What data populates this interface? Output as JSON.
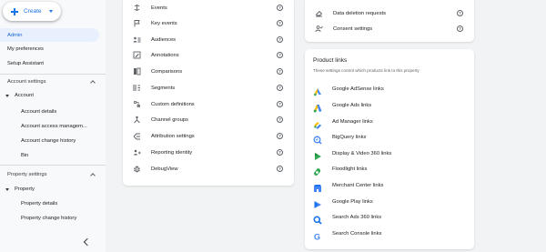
{
  "sidebar": {
    "create_label": "Create",
    "admin_label": "Admin",
    "my_preferences_label": "My preferences",
    "setup_assistant_label": "Setup Assistant",
    "account_settings": {
      "heading": "Account settings",
      "tree_label": "Account",
      "items": [
        "Account details",
        "Account access managem...",
        "Account change history",
        "Bin"
      ]
    },
    "property_settings": {
      "heading": "Property settings",
      "tree_label": "Property",
      "items": [
        "Property details",
        "Property change history"
      ]
    }
  },
  "data_display": {
    "items": [
      {
        "label": "Events",
        "icon": "events-icon"
      },
      {
        "label": "Key events",
        "icon": "flag-icon"
      },
      {
        "label": "Audiences",
        "icon": "audiences-icon"
      },
      {
        "label": "Annotations",
        "icon": "annotations-icon"
      },
      {
        "label": "Comparisons",
        "icon": "comparisons-icon"
      },
      {
        "label": "Segments",
        "icon": "segments-icon"
      },
      {
        "label": "Custom definitions",
        "icon": "custom-definitions-icon"
      },
      {
        "label": "Channel groups",
        "icon": "channel-groups-icon"
      },
      {
        "label": "Attribution settings",
        "icon": "attribution-icon"
      },
      {
        "label": "Reporting identity",
        "icon": "reporting-identity-icon"
      },
      {
        "label": "DebugView",
        "icon": "debug-icon"
      }
    ]
  },
  "data_settings": {
    "items": [
      {
        "label": "Data deletion requests",
        "icon": "eraser-icon"
      },
      {
        "label": "Consent settings",
        "icon": "consent-icon"
      }
    ]
  },
  "product_links": {
    "title": "Product links",
    "subtitle": "These settings control which products link to this property",
    "items": [
      {
        "label": "Google AdSense links",
        "icon": "adsense-icon"
      },
      {
        "label": "Google Ads links",
        "icon": "google-ads-icon"
      },
      {
        "label": "Ad Manager links",
        "icon": "ad-manager-icon"
      },
      {
        "label": "BigQuery links",
        "icon": "bigquery-icon"
      },
      {
        "label": "Display & Video 360 links",
        "icon": "dv360-icon"
      },
      {
        "label": "Floodlight links",
        "icon": "floodlight-icon"
      },
      {
        "label": "Merchant Center links",
        "icon": "merchant-center-icon"
      },
      {
        "label": "Google Play links",
        "icon": "google-play-icon"
      },
      {
        "label": "Search Ads 360 links",
        "icon": "search-ads-360-icon"
      },
      {
        "label": "Search Console links",
        "icon": "search-console-icon"
      }
    ]
  },
  "colors": {
    "accent": "#1a73e8",
    "active_bg": "#e8f0fe",
    "page_bg": "#f1f3f4"
  }
}
